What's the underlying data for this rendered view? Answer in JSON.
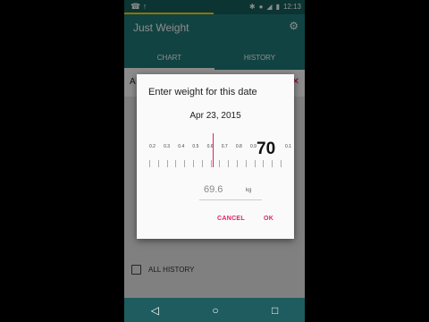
{
  "status_bar": {
    "time": "12:13"
  },
  "app_bar": {
    "title": "Just Weight",
    "tabs": [
      "CHART",
      "HISTORY"
    ]
  },
  "content": {
    "list_row_prefix": "A",
    "all_history_label": "ALL HISTORY"
  },
  "dialog": {
    "title": "Enter weight for this date",
    "date": "Apr 23, 2015",
    "ruler_labels": [
      "0.2",
      "0.3",
      "0.4",
      "0.5",
      "0.6",
      "0.7",
      "0.8",
      "0.9"
    ],
    "ruler_value": "70",
    "ruler_next_label": "0.1",
    "weight_input": "69.6",
    "unit": "kg",
    "cancel": "CANCEL",
    "ok": "OK"
  },
  "navbar": {
    "back": "back-icon",
    "home": "home-icon",
    "recents": "recents-icon"
  },
  "colors": {
    "primary": "#1f7b78",
    "accent": "#e91e63",
    "loading": "#ffd400"
  }
}
